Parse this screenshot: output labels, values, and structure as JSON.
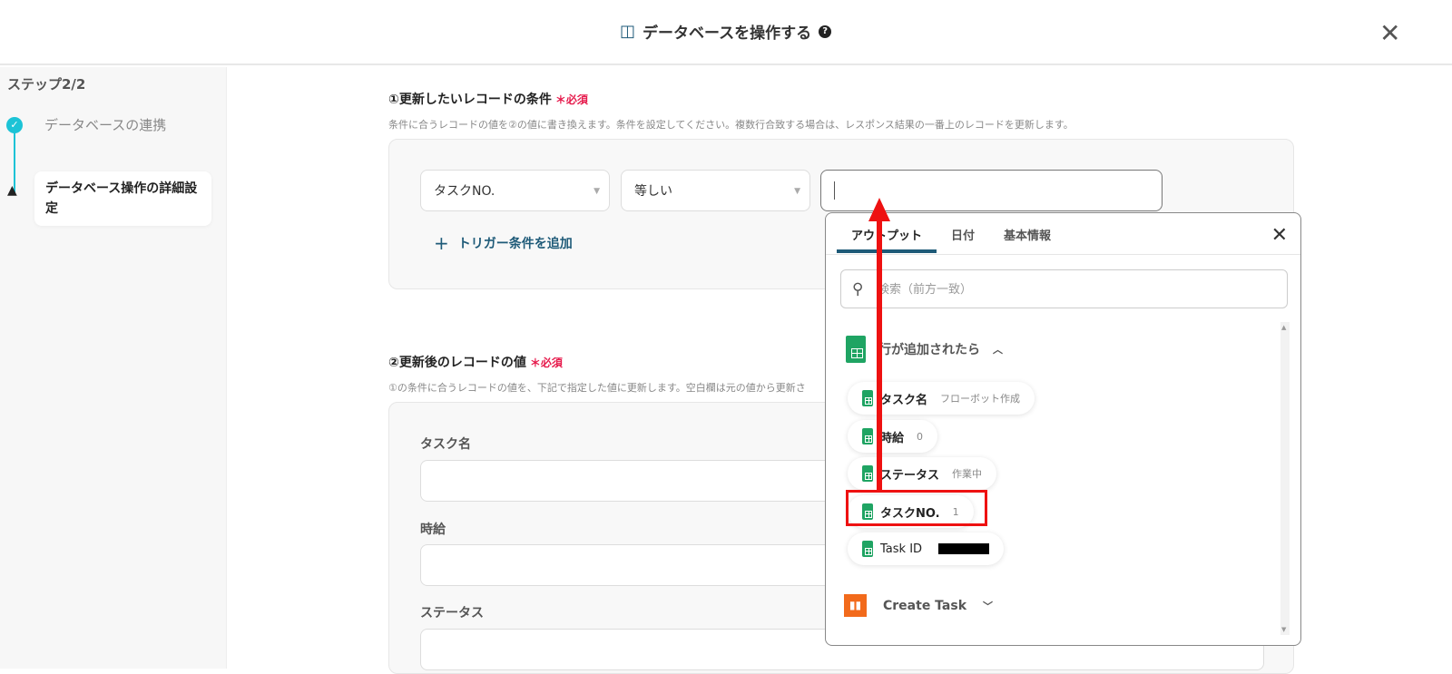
{
  "header": {
    "title": "データベースを操作する",
    "help_icon": "?"
  },
  "sidebar": {
    "step": "ステップ2/2",
    "steps": [
      {
        "label": "データベースの連携",
        "state": "done"
      },
      {
        "label": "データベース操作の詳細設定",
        "state": "warning"
      }
    ]
  },
  "section1": {
    "title": "①更新したいレコードの条件",
    "required": "必須",
    "description": "条件に合うレコードの値を②の値に書き換えます。条件を設定してください。複数行合致する場合は、レスポンス結果の一番上のレコードを更新します。",
    "field": "タスクNO.",
    "operator": "等しい",
    "value": "",
    "add_label": "トリガー条件を追加"
  },
  "section2": {
    "title": "②更新後のレコードの値",
    "required": "必須",
    "description": "①の条件に合うレコードの値を、下記で指定した値に更新します。空白欄は元の値から更新さ",
    "fields": [
      "タスク名",
      "時給",
      "ステータス"
    ]
  },
  "popup": {
    "tabs": [
      "アウトプット",
      "日付",
      "基本情報"
    ],
    "active_tab": 0,
    "search_placeholder": "検索（前方一致）",
    "group": "行が追加されたら",
    "items": [
      {
        "label": "タスク名",
        "value": "フローボット作成"
      },
      {
        "label": "時給",
        "value": "0"
      },
      {
        "label": "ステータス",
        "value": "作業中"
      },
      {
        "label": "タスクNO.",
        "value": "1"
      },
      {
        "label": "Task ID",
        "value": ""
      }
    ],
    "group2": "Create Task"
  },
  "colors": {
    "accent": "#1e5a78",
    "teal": "#1cc3d6",
    "required": "#e6194b",
    "highlight": "#ee1111"
  }
}
